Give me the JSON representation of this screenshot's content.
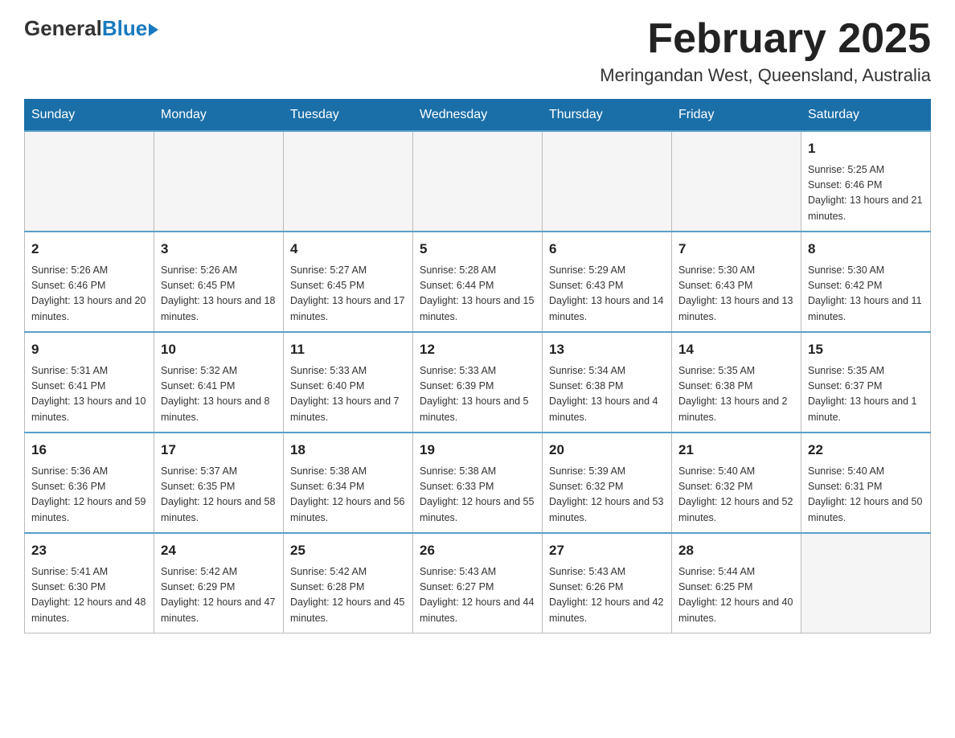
{
  "logo": {
    "general": "General",
    "blue": "Blue"
  },
  "title": {
    "month_year": "February 2025",
    "location": "Meringandan West, Queensland, Australia"
  },
  "days_of_week": [
    "Sunday",
    "Monday",
    "Tuesday",
    "Wednesday",
    "Thursday",
    "Friday",
    "Saturday"
  ],
  "weeks": [
    {
      "days": [
        {
          "num": "",
          "info": ""
        },
        {
          "num": "",
          "info": ""
        },
        {
          "num": "",
          "info": ""
        },
        {
          "num": "",
          "info": ""
        },
        {
          "num": "",
          "info": ""
        },
        {
          "num": "",
          "info": ""
        },
        {
          "num": "1",
          "info": "Sunrise: 5:25 AM\nSunset: 6:46 PM\nDaylight: 13 hours and 21 minutes."
        }
      ]
    },
    {
      "days": [
        {
          "num": "2",
          "info": "Sunrise: 5:26 AM\nSunset: 6:46 PM\nDaylight: 13 hours and 20 minutes."
        },
        {
          "num": "3",
          "info": "Sunrise: 5:26 AM\nSunset: 6:45 PM\nDaylight: 13 hours and 18 minutes."
        },
        {
          "num": "4",
          "info": "Sunrise: 5:27 AM\nSunset: 6:45 PM\nDaylight: 13 hours and 17 minutes."
        },
        {
          "num": "5",
          "info": "Sunrise: 5:28 AM\nSunset: 6:44 PM\nDaylight: 13 hours and 15 minutes."
        },
        {
          "num": "6",
          "info": "Sunrise: 5:29 AM\nSunset: 6:43 PM\nDaylight: 13 hours and 14 minutes."
        },
        {
          "num": "7",
          "info": "Sunrise: 5:30 AM\nSunset: 6:43 PM\nDaylight: 13 hours and 13 minutes."
        },
        {
          "num": "8",
          "info": "Sunrise: 5:30 AM\nSunset: 6:42 PM\nDaylight: 13 hours and 11 minutes."
        }
      ]
    },
    {
      "days": [
        {
          "num": "9",
          "info": "Sunrise: 5:31 AM\nSunset: 6:41 PM\nDaylight: 13 hours and 10 minutes."
        },
        {
          "num": "10",
          "info": "Sunrise: 5:32 AM\nSunset: 6:41 PM\nDaylight: 13 hours and 8 minutes."
        },
        {
          "num": "11",
          "info": "Sunrise: 5:33 AM\nSunset: 6:40 PM\nDaylight: 13 hours and 7 minutes."
        },
        {
          "num": "12",
          "info": "Sunrise: 5:33 AM\nSunset: 6:39 PM\nDaylight: 13 hours and 5 minutes."
        },
        {
          "num": "13",
          "info": "Sunrise: 5:34 AM\nSunset: 6:38 PM\nDaylight: 13 hours and 4 minutes."
        },
        {
          "num": "14",
          "info": "Sunrise: 5:35 AM\nSunset: 6:38 PM\nDaylight: 13 hours and 2 minutes."
        },
        {
          "num": "15",
          "info": "Sunrise: 5:35 AM\nSunset: 6:37 PM\nDaylight: 13 hours and 1 minute."
        }
      ]
    },
    {
      "days": [
        {
          "num": "16",
          "info": "Sunrise: 5:36 AM\nSunset: 6:36 PM\nDaylight: 12 hours and 59 minutes."
        },
        {
          "num": "17",
          "info": "Sunrise: 5:37 AM\nSunset: 6:35 PM\nDaylight: 12 hours and 58 minutes."
        },
        {
          "num": "18",
          "info": "Sunrise: 5:38 AM\nSunset: 6:34 PM\nDaylight: 12 hours and 56 minutes."
        },
        {
          "num": "19",
          "info": "Sunrise: 5:38 AM\nSunset: 6:33 PM\nDaylight: 12 hours and 55 minutes."
        },
        {
          "num": "20",
          "info": "Sunrise: 5:39 AM\nSunset: 6:32 PM\nDaylight: 12 hours and 53 minutes."
        },
        {
          "num": "21",
          "info": "Sunrise: 5:40 AM\nSunset: 6:32 PM\nDaylight: 12 hours and 52 minutes."
        },
        {
          "num": "22",
          "info": "Sunrise: 5:40 AM\nSunset: 6:31 PM\nDaylight: 12 hours and 50 minutes."
        }
      ]
    },
    {
      "days": [
        {
          "num": "23",
          "info": "Sunrise: 5:41 AM\nSunset: 6:30 PM\nDaylight: 12 hours and 48 minutes."
        },
        {
          "num": "24",
          "info": "Sunrise: 5:42 AM\nSunset: 6:29 PM\nDaylight: 12 hours and 47 minutes."
        },
        {
          "num": "25",
          "info": "Sunrise: 5:42 AM\nSunset: 6:28 PM\nDaylight: 12 hours and 45 minutes."
        },
        {
          "num": "26",
          "info": "Sunrise: 5:43 AM\nSunset: 6:27 PM\nDaylight: 12 hours and 44 minutes."
        },
        {
          "num": "27",
          "info": "Sunrise: 5:43 AM\nSunset: 6:26 PM\nDaylight: 12 hours and 42 minutes."
        },
        {
          "num": "28",
          "info": "Sunrise: 5:44 AM\nSunset: 6:25 PM\nDaylight: 12 hours and 40 minutes."
        },
        {
          "num": "",
          "info": ""
        }
      ]
    }
  ]
}
